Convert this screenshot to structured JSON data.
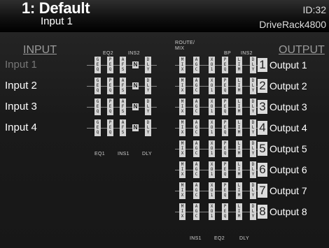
{
  "header": {
    "preset_title": "1: Default",
    "selected_channel": "Input 1",
    "device_id": "ID:32",
    "device_name": "DriveRack4800"
  },
  "columns": {
    "input_heading": "INPUT",
    "output_heading": "OUTPUT"
  },
  "section_labels": {
    "input_top": [
      "EQ2",
      "INS2"
    ],
    "input_bottom": [
      "EQ1",
      "INS1",
      "DLY"
    ],
    "route_mix": "ROUTE/\nMIX",
    "output_top": [
      "BP",
      "INS2"
    ],
    "output_bottom": [
      "INS1",
      "EQ2",
      "DLY"
    ]
  },
  "inputs": [
    {
      "label": "Input 1",
      "selected": true
    },
    {
      "label": "Input 2",
      "selected": false
    },
    {
      "label": "Input 3",
      "selected": false
    },
    {
      "label": "Input 4",
      "selected": false
    }
  ],
  "input_chain_blocks": [
    "GEQ",
    "PEQ",
    "AFS",
    "N",
    "DLY"
  ],
  "output_chain_blocks": [
    "MIX",
    "AGC",
    "XO1",
    "PEQ",
    "LIM",
    "DLY"
  ],
  "outputs": [
    {
      "number": "1",
      "label": "Output 1"
    },
    {
      "number": "2",
      "label": "Output 2"
    },
    {
      "number": "3",
      "label": "Output 3"
    },
    {
      "number": "4",
      "label": "Output 4"
    },
    {
      "number": "5",
      "label": "Output 5"
    },
    {
      "number": "6",
      "label": "Output 6"
    },
    {
      "number": "7",
      "label": "Output 7"
    },
    {
      "number": "8",
      "label": "Output 8"
    }
  ]
}
